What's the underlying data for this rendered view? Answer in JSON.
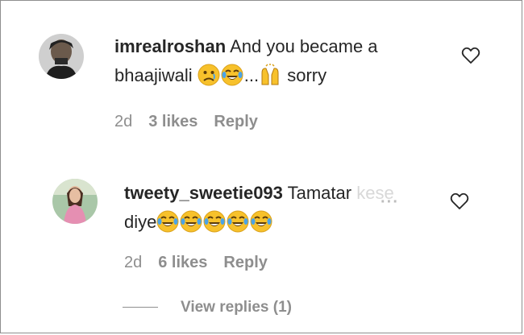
{
  "comments": [
    {
      "username": "imrealroshan",
      "text_line1": "And you became a",
      "text_line2_start": "bhaajiwali",
      "text_line2_sep": "...",
      "text_line2_end": "sorry",
      "emojis": [
        "sad-face",
        "tears-of-joy"
      ],
      "emoji_end": "raised-hands",
      "time": "2d",
      "likes": "3 likes",
      "reply": "Reply"
    },
    {
      "username": "tweety_sweetie093",
      "text_line1": "Tamatar",
      "text_line1_faded": "kese",
      "text_line2": "diye",
      "emojis": [
        "tears-of-joy",
        "tears-of-joy",
        "tears-of-joy",
        "tears-of-joy",
        "tears-of-joy"
      ],
      "more": "···",
      "time": "2d",
      "likes": "6 likes",
      "reply": "Reply",
      "view_replies": "View replies (1)"
    }
  ],
  "colors": {
    "text": "#262626",
    "secondary": "#8e8e8e",
    "emoji_yellow": "#f7c12b"
  }
}
